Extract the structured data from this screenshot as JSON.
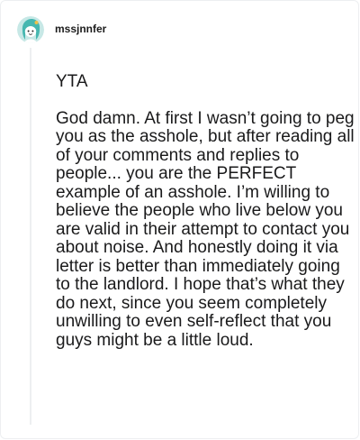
{
  "comment": {
    "author": "mssjnnfer",
    "avatar_icon": "snoo-avatar-icon",
    "paragraphs": [
      "YTA",
      "God damn. At first I wasn’t going to peg you as the asshole, but after reading all of your comments and replies to people... you are the PERFECT example of an asshole. I’m willing to believe the people who live below you are valid in their attempt to contact you about noise. And honestly doing it via letter is better than immediately going to the landlord. I hope that’s what they do next, since you seem completely unwilling to even self-reflect that you guys might be a little loud."
    ]
  },
  "colors": {
    "avatar_bg": "#c7e8e6",
    "avatar_hair": "#46b7b0",
    "thread_line": "#edeff1",
    "text": "#1a1a1b"
  }
}
